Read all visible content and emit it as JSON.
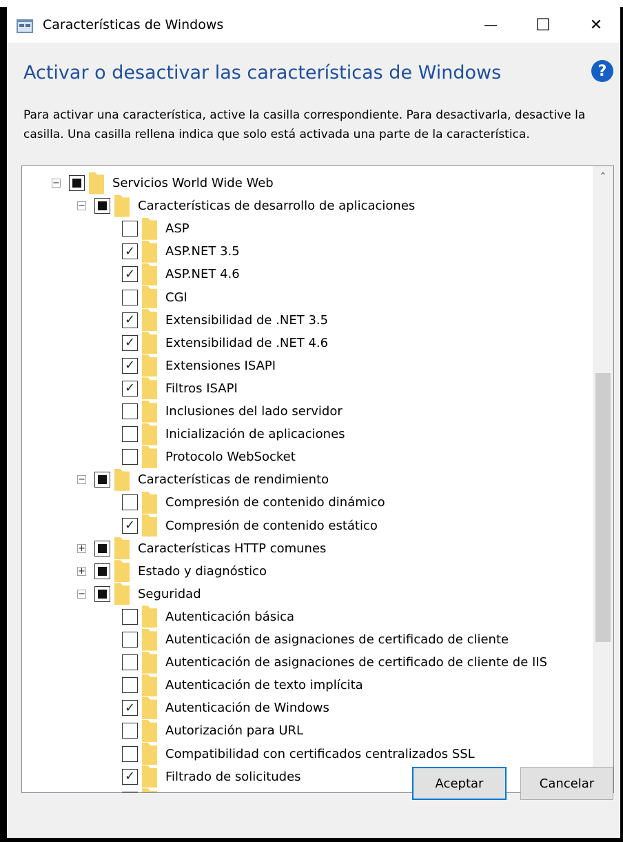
{
  "window": {
    "title": "Características de Windows",
    "minimize_glyph": "—",
    "maximize_glyph": "☐",
    "close_glyph": "✕"
  },
  "heading": "Activar o desactivar las características de Windows",
  "help_glyph": "?",
  "description": "Para activar una característica, active la casilla correspondiente. Para desactivarla, desactive la casilla. Una casilla rellena indica que solo está activada una parte de la característica.",
  "tree": [
    {
      "label": "Servicios World Wide Web",
      "level": 0,
      "state": "partial",
      "expander": "minus"
    },
    {
      "label": "Características de desarrollo de aplicaciones",
      "level": 1,
      "state": "partial",
      "expander": "minus"
    },
    {
      "label": "ASP",
      "level": 2,
      "state": "unchecked"
    },
    {
      "label": "ASP.NET 3.5",
      "level": 2,
      "state": "checked"
    },
    {
      "label": "ASP.NET 4.6",
      "level": 2,
      "state": "checked"
    },
    {
      "label": "CGI",
      "level": 2,
      "state": "unchecked"
    },
    {
      "label": "Extensibilidad de .NET 3.5",
      "level": 2,
      "state": "checked"
    },
    {
      "label": "Extensibilidad de .NET 4.6",
      "level": 2,
      "state": "checked"
    },
    {
      "label": "Extensiones ISAPI",
      "level": 2,
      "state": "checked"
    },
    {
      "label": "Filtros ISAPI",
      "level": 2,
      "state": "checked"
    },
    {
      "label": "Inclusiones del lado servidor",
      "level": 2,
      "state": "unchecked"
    },
    {
      "label": "Inicialización de aplicaciones",
      "level": 2,
      "state": "unchecked"
    },
    {
      "label": "Protocolo WebSocket",
      "level": 2,
      "state": "unchecked"
    },
    {
      "label": "Características de rendimiento",
      "level": 1,
      "state": "partial",
      "expander": "minus"
    },
    {
      "label": "Compresión de contenido dinámico",
      "level": 2,
      "state": "unchecked"
    },
    {
      "label": "Compresión de contenido estático",
      "level": 2,
      "state": "checked"
    },
    {
      "label": "Características HTTP comunes",
      "level": 1,
      "state": "partial",
      "expander": "plus"
    },
    {
      "label": "Estado y diagnóstico",
      "level": 1,
      "state": "partial",
      "expander": "plus"
    },
    {
      "label": "Seguridad",
      "level": 1,
      "state": "partial",
      "expander": "minus"
    },
    {
      "label": "Autenticación básica",
      "level": 2,
      "state": "unchecked"
    },
    {
      "label": "Autenticación de asignaciones de certificado de cliente",
      "level": 2,
      "state": "unchecked"
    },
    {
      "label": "Autenticación de asignaciones de certificado de cliente de IIS",
      "level": 2,
      "state": "unchecked"
    },
    {
      "label": "Autenticación de texto implícita",
      "level": 2,
      "state": "unchecked"
    },
    {
      "label": "Autenticación de Windows",
      "level": 2,
      "state": "checked"
    },
    {
      "label": "Autorización para URL",
      "level": 2,
      "state": "unchecked"
    },
    {
      "label": "Compatibilidad con certificados centralizados SSL",
      "level": 2,
      "state": "unchecked"
    },
    {
      "label": "Filtrado de solicitudes",
      "level": 2,
      "state": "checked"
    },
    {
      "label": "",
      "level": 2,
      "state": "checked"
    }
  ],
  "buttons": {
    "ok": "Aceptar",
    "cancel": "Cancelar"
  },
  "colors": {
    "heading": "#1e4fa0",
    "folder": "#f8d568",
    "primary_border": "#0078d7"
  }
}
